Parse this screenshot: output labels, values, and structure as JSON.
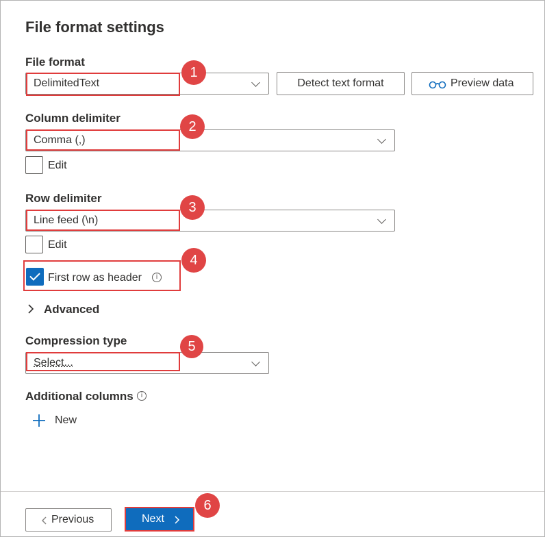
{
  "panel": {
    "title": "File format settings"
  },
  "file_format": {
    "label": "File format",
    "value": "DelimitedText",
    "detect_button": "Detect text format",
    "preview_button": "Preview data"
  },
  "column_delimiter": {
    "label": "Column delimiter",
    "value": "Comma (,)",
    "edit_label": "Edit",
    "edit_checked": false
  },
  "row_delimiter": {
    "label": "Row delimiter",
    "value": "Line feed (\\n)",
    "edit_label": "Edit",
    "edit_checked": false
  },
  "first_row_header": {
    "label": "First row as header",
    "checked": true
  },
  "advanced": {
    "label": "Advanced"
  },
  "compression": {
    "label": "Compression type",
    "placeholder": "Select..."
  },
  "additional_columns": {
    "label": "Additional columns",
    "new_label": "New"
  },
  "footer": {
    "previous_label": "Previous",
    "next_label": "Next"
  },
  "callouts": [
    "1",
    "2",
    "3",
    "4",
    "5",
    "6"
  ],
  "colors": {
    "accent": "#0f6cbd",
    "callout": "#e04545",
    "highlight_border": "#e03c3c"
  },
  "icons": {
    "preview": "glasses-icon",
    "info": "info-icon",
    "advanced": "chevron-right-icon",
    "new": "plus-icon"
  }
}
